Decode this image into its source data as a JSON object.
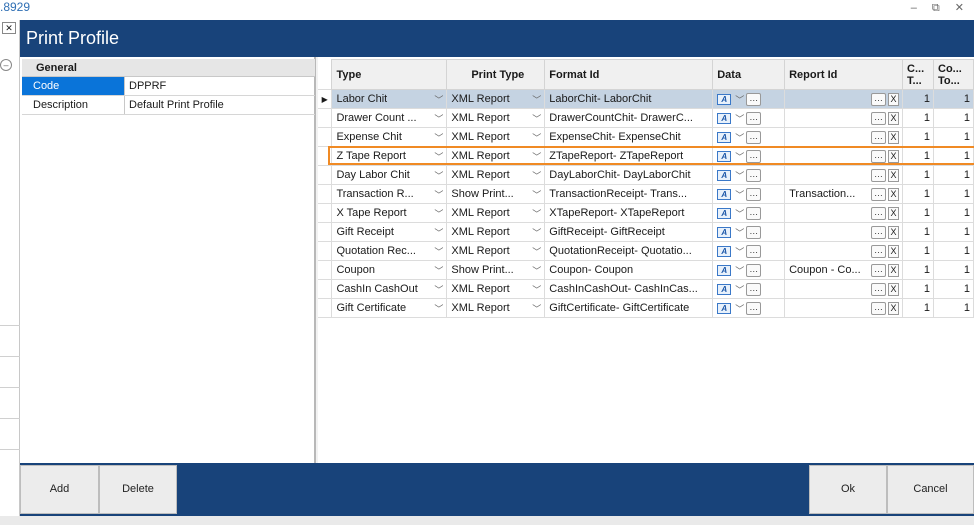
{
  "outer": {
    "top_number": ".8929",
    "window_controls": "–  ⧉  ✕"
  },
  "dialog": {
    "title": "Print Profile"
  },
  "properties": {
    "section": "General",
    "rows": [
      {
        "key": "Code",
        "value": "DPPRF"
      },
      {
        "key": "Description",
        "value": "Default Print Profile"
      }
    ]
  },
  "grid": {
    "columns": {
      "type": "Type",
      "print_type": "Print Type",
      "format_id": "Format Id",
      "data": "Data",
      "report_id": "Report Id",
      "col_c": "C... T...",
      "col_co": "Co... To..."
    },
    "rows": [
      {
        "type": "Labor Chit",
        "print_type": "XML Report",
        "format_id": "LaborChit- LaborChit",
        "report_id": "",
        "c": "1",
        "co": "1"
      },
      {
        "type": "Drawer Count ...",
        "print_type": "XML Report",
        "format_id": "DrawerCountChit- DrawerC...",
        "report_id": "",
        "c": "1",
        "co": "1"
      },
      {
        "type": "Expense Chit",
        "print_type": "XML Report",
        "format_id": "ExpenseChit- ExpenseChit",
        "report_id": "",
        "c": "1",
        "co": "1"
      },
      {
        "type": "Z Tape Report",
        "print_type": "XML Report",
        "format_id": "ZTapeReport- ZTapeReport",
        "report_id": "",
        "c": "1",
        "co": "1"
      },
      {
        "type": "Day Labor Chit",
        "print_type": "XML Report",
        "format_id": "DayLaborChit- DayLaborChit",
        "report_id": "",
        "c": "1",
        "co": "1"
      },
      {
        "type": "Transaction R...",
        "print_type": "Show Print...",
        "format_id": "TransactionReceipt- Trans...",
        "report_id": "Transaction...",
        "c": "1",
        "co": "1"
      },
      {
        "type": "X Tape Report",
        "print_type": "XML Report",
        "format_id": "XTapeReport- XTapeReport",
        "report_id": "",
        "c": "1",
        "co": "1"
      },
      {
        "type": "Gift Receipt",
        "print_type": "XML Report",
        "format_id": "GiftReceipt- GiftReceipt",
        "report_id": "",
        "c": "1",
        "co": "1"
      },
      {
        "type": "Quotation Rec...",
        "print_type": "XML Report",
        "format_id": "QuotationReceipt- Quotatio...",
        "report_id": "",
        "c": "1",
        "co": "1"
      },
      {
        "type": "Coupon",
        "print_type": "Show Print...",
        "format_id": "Coupon- Coupon",
        "report_id": "Coupon - Co...",
        "c": "1",
        "co": "1"
      },
      {
        "type": "CashIn CashOut",
        "print_type": "XML Report",
        "format_id": "CashInCashOut- CashInCas...",
        "report_id": "",
        "c": "1",
        "co": "1"
      },
      {
        "type": "Gift Certificate",
        "print_type": "XML Report",
        "format_id": "GiftCertificate- GiftCertificate",
        "report_id": "",
        "c": "1",
        "co": "1"
      }
    ]
  },
  "buttons": {
    "add": "Add",
    "delete": "Delete",
    "ok": "Ok",
    "cancel": "Cancel"
  },
  "icons": {
    "row_indicator": "current-row-arrow-icon",
    "data_text": "A"
  },
  "colors": {
    "title_bar": "#18437a",
    "selected_key": "#0a74d9",
    "highlight": "#f08a24",
    "active_row": "#c5d3e2"
  }
}
